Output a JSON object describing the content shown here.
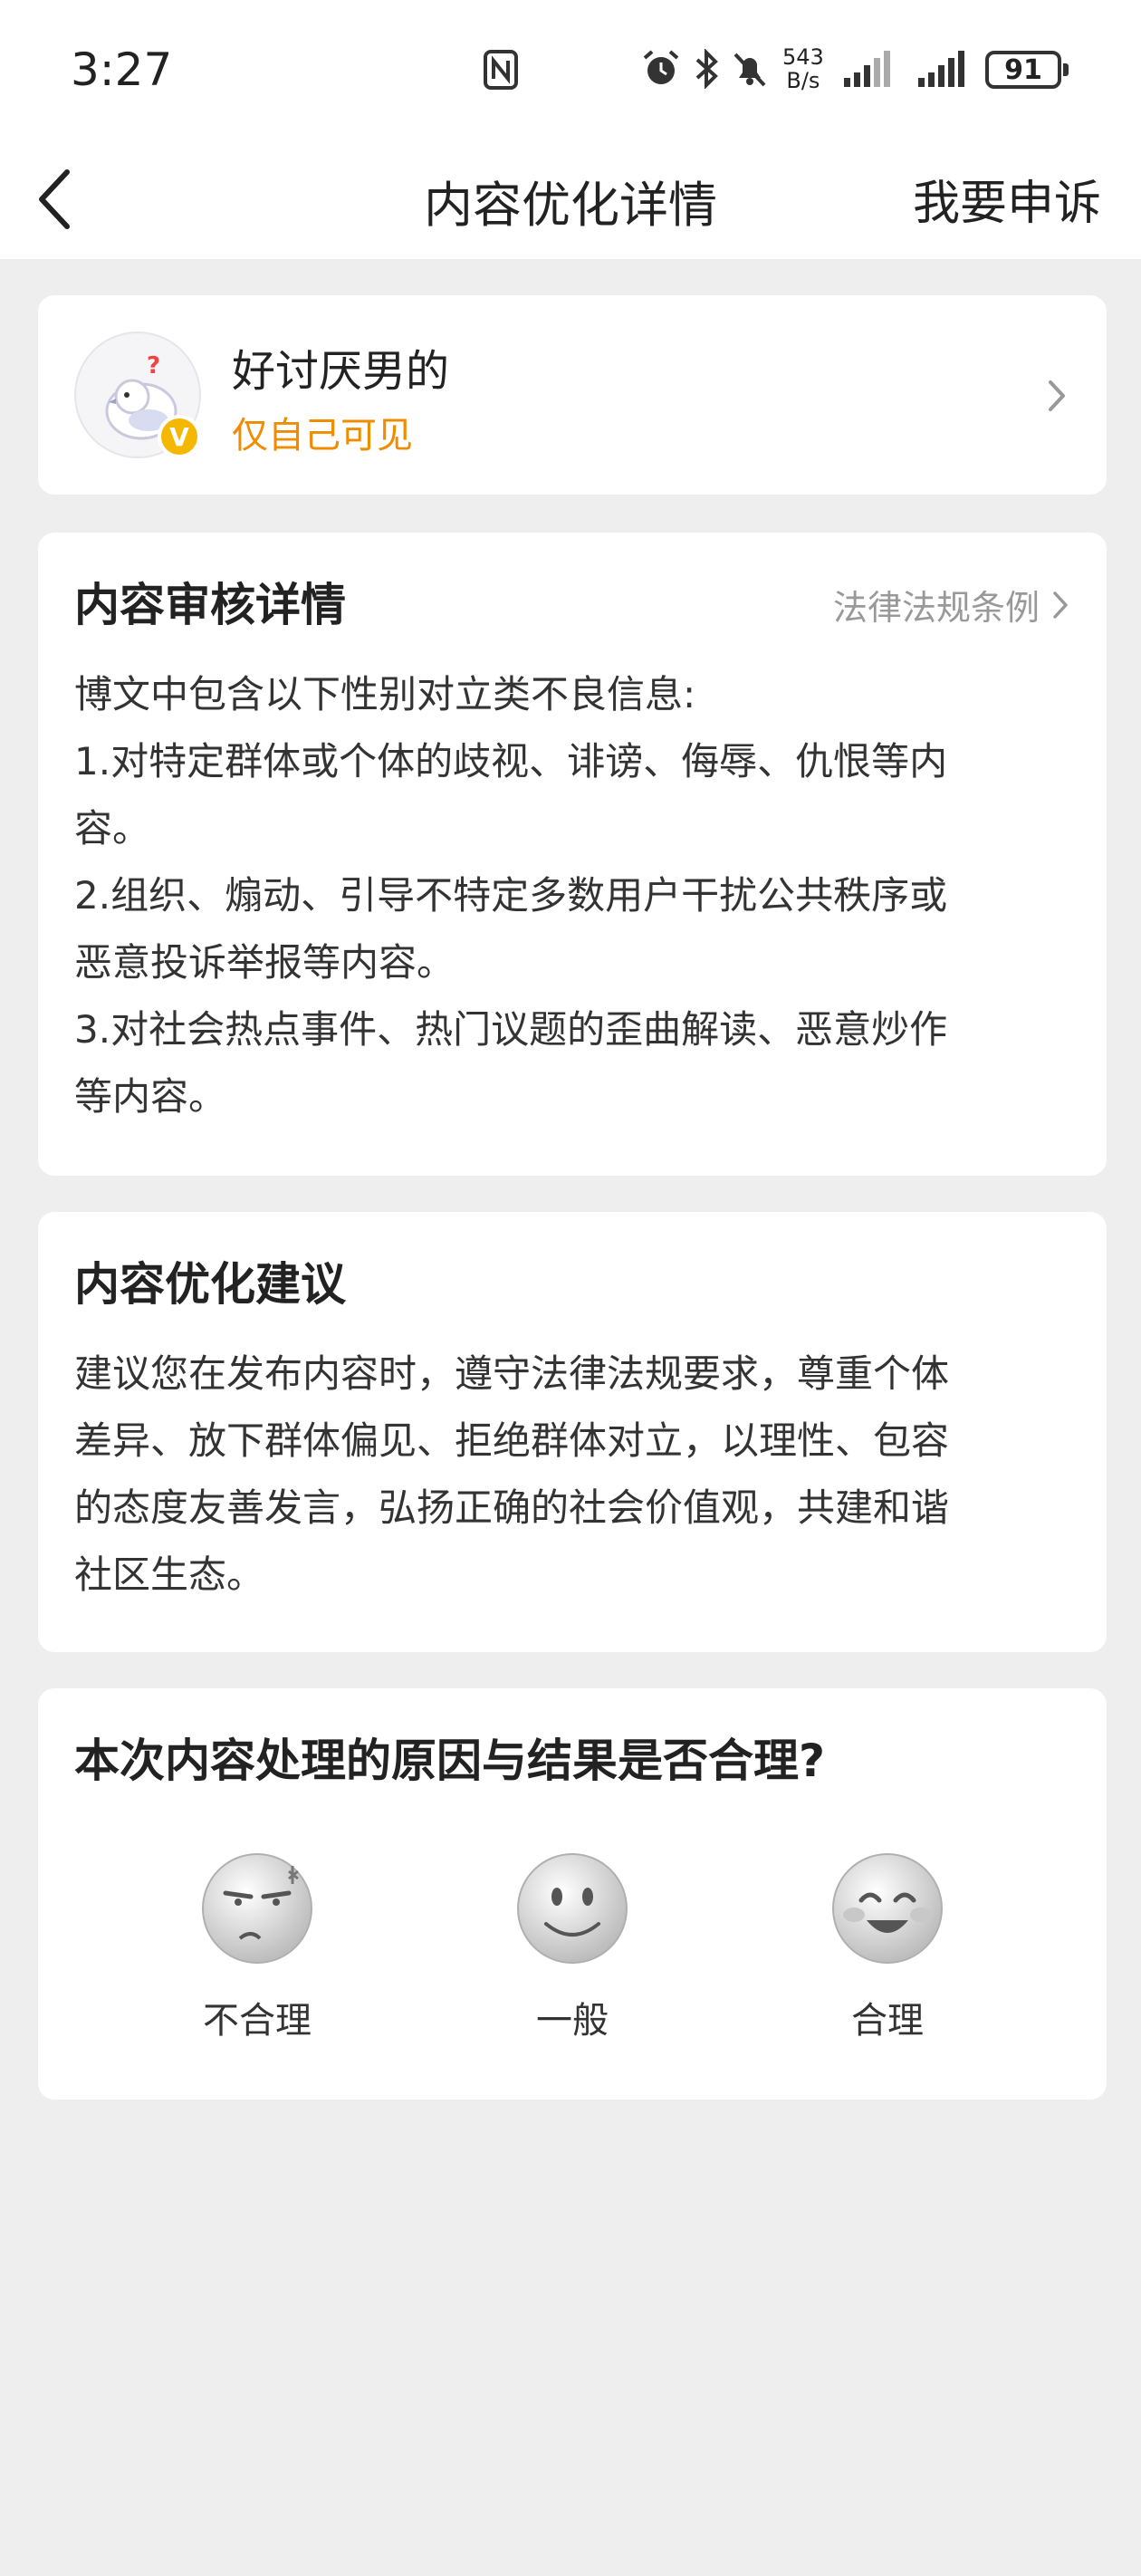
{
  "status_bar": {
    "time": "3:27",
    "net_speed_value": "543",
    "net_speed_unit": "B/s",
    "battery": "91"
  },
  "header": {
    "title": "内容优化详情",
    "appeal_label": "我要申诉"
  },
  "user": {
    "name": "好讨厌男的",
    "visibility": "仅自己可见",
    "verified_badge": "V"
  },
  "review": {
    "title": "内容审核详情",
    "law_link": "法律法规条例",
    "lines": [
      "博文中包含以下性别对立类不良信息:",
      "1.对特定群体或个体的歧视、诽谤、侮辱、仇恨等内",
      "容。",
      "2.组织、煽动、引导不特定多数用户干扰公共秩序或",
      "恶意投诉举报等内容。",
      "3.对社会热点事件、热门议题的歪曲解读、恶意炒作",
      "等内容。"
    ]
  },
  "suggestion": {
    "title": "内容优化建议",
    "lines": [
      "建议您在发布内容时，遵守法律法规要求，尊重个体",
      "差异、放下群体偏见、拒绝群体对立，以理性、包容",
      "的态度友善发言，弘扬正确的社会价值观，共建和谐",
      "社区生态。"
    ]
  },
  "rating": {
    "question": "本次内容处理的原因与结果是否合理?",
    "options": [
      {
        "label": "不合理",
        "icon": "angry-face-icon"
      },
      {
        "label": "一般",
        "icon": "neutral-face-icon"
      },
      {
        "label": "合理",
        "icon": "happy-face-icon"
      }
    ]
  },
  "colors": {
    "accent_orange": "#f08c00",
    "badge_yellow": "#f5b800",
    "background": "#eeeeee"
  }
}
